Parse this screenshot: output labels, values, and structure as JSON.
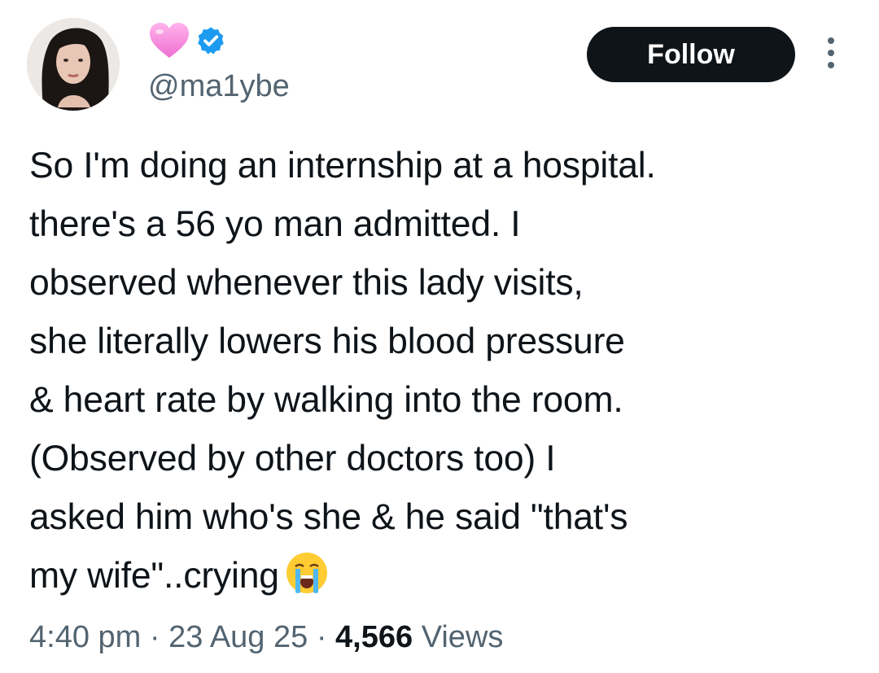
{
  "author": {
    "handle": "@ma1ybe",
    "badges": [
      "pink-heart-icon",
      "verified-badge-icon"
    ]
  },
  "follow_button": {
    "label": "Follow"
  },
  "more_button": {
    "icon": "more-vertical-icon"
  },
  "tweet": {
    "lines": [
      "So I'm doing an internship at a hospital.",
      "there's a 56 yo man admitted. I",
      "observed whenever this lady visits,",
      "she literally lowers his blood pressure",
      "& heart rate by walking into the room.",
      "(Observed by other doctors too) I",
      "asked him who's she & he said \"that's",
      "my wife\"..crying"
    ],
    "emoji": "loudly-crying-face-icon"
  },
  "meta": {
    "time": "4:40 pm",
    "sep1": "·",
    "date": "23 Aug 25",
    "sep2": "·",
    "views_count": "4,566",
    "views_label": "Views"
  },
  "colors": {
    "text": "#0f1419",
    "secondary": "#536471",
    "verified": "#1d9bf0",
    "button_bg": "#0f1419",
    "heart": "#f58ad9"
  }
}
